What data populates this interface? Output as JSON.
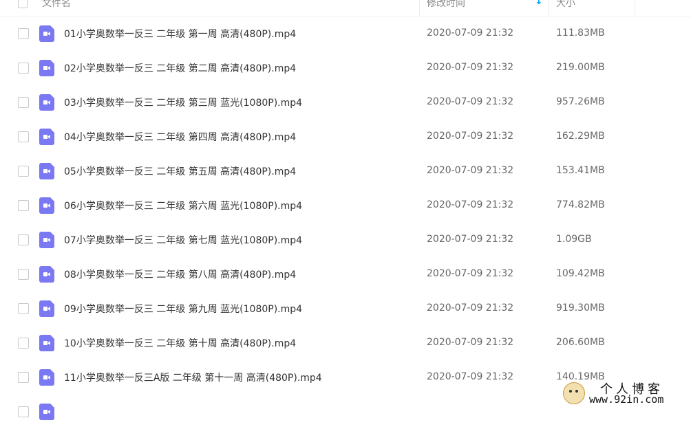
{
  "header": {
    "name_col": "文件名",
    "time_col": "修改时间",
    "size_col": "大小",
    "sort_icon": "arrow-down-icon"
  },
  "files": [
    {
      "name": "01小学奥数举一反三 二年级 第一周 高清(480P).mp4",
      "time": "2020-07-09 21:32",
      "size": "111.83MB"
    },
    {
      "name": "02小学奥数举一反三 二年级 第二周 高清(480P).mp4",
      "time": "2020-07-09 21:32",
      "size": "219.00MB"
    },
    {
      "name": "03小学奥数举一反三 二年级 第三周 蓝光(1080P).mp4",
      "time": "2020-07-09 21:32",
      "size": "957.26MB"
    },
    {
      "name": "04小学奥数举一反三 二年级 第四周 高清(480P).mp4",
      "time": "2020-07-09 21:32",
      "size": "162.29MB"
    },
    {
      "name": "05小学奥数举一反三 二年级 第五周 高清(480P).mp4",
      "time": "2020-07-09 21:32",
      "size": "153.41MB"
    },
    {
      "name": "06小学奥数举一反三 二年级 第六周 蓝光(1080P).mp4",
      "time": "2020-07-09 21:32",
      "size": "774.82MB"
    },
    {
      "name": "07小学奥数举一反三 二年级 第七周 蓝光(1080P).mp4",
      "time": "2020-07-09 21:32",
      "size": "1.09GB"
    },
    {
      "name": "08小学奥数举一反三 二年级 第八周 高清(480P).mp4",
      "time": "2020-07-09 21:32",
      "size": "109.42MB"
    },
    {
      "name": "09小学奥数举一反三 二年级 第九周 蓝光(1080P).mp4",
      "time": "2020-07-09 21:32",
      "size": "919.30MB"
    },
    {
      "name": "10小学奥数举一反三 二年级 第十周 高清(480P).mp4",
      "time": "2020-07-09 21:32",
      "size": "206.60MB"
    },
    {
      "name": "11小学奥数举一反三A版 二年级 第十一周 高清(480P).mp4",
      "time": "2020-07-09 21:32",
      "size": "140.19MB"
    }
  ],
  "watermark": {
    "title": "个人博客",
    "url": "www.92in.com",
    "logo_icon": "avatar-logo-icon"
  },
  "colors": {
    "video_icon": "#7b78f4",
    "sort_accent": "#06a7ff"
  }
}
